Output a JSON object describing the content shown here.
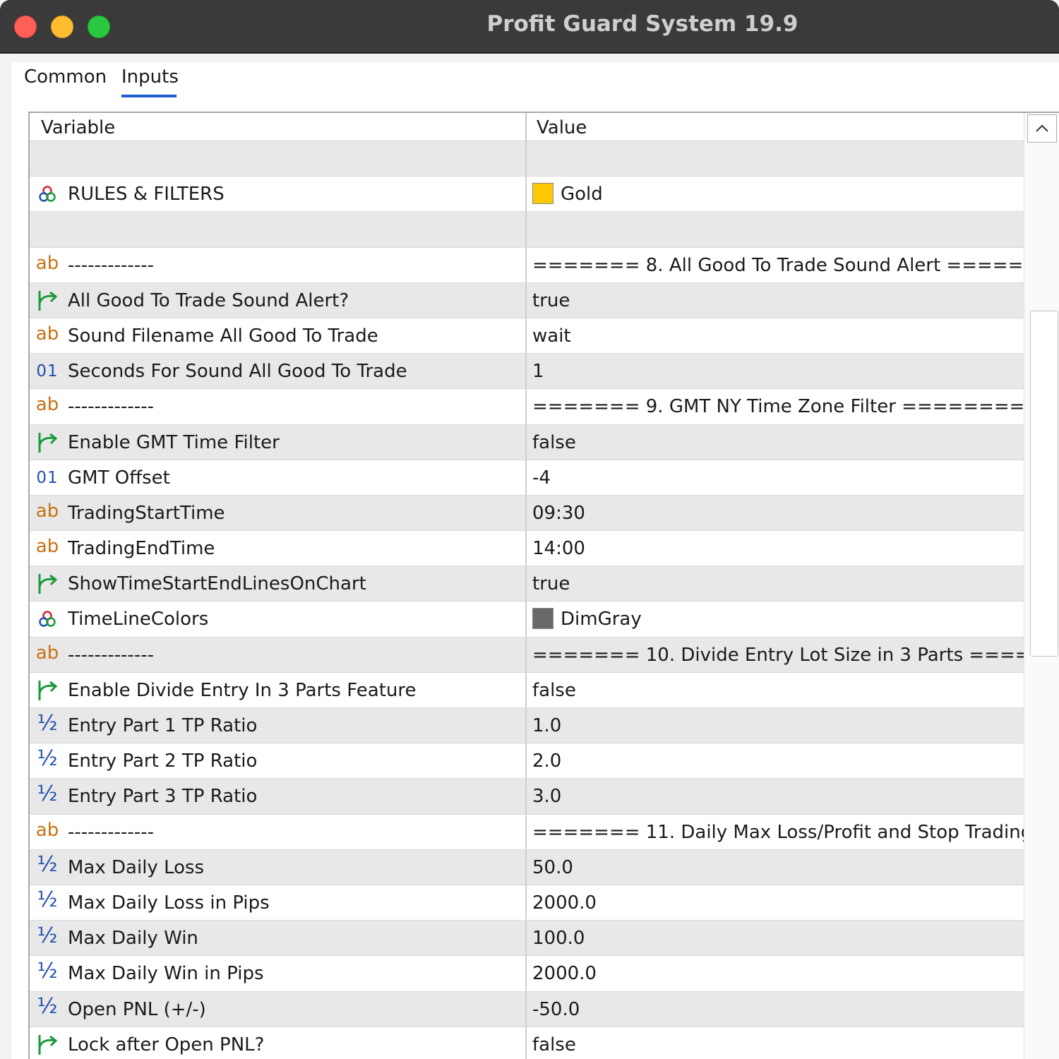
{
  "window": {
    "title": "Profit Guard System 19.9"
  },
  "tabs": [
    {
      "label": "Common"
    },
    {
      "label": "Inputs",
      "active": true
    }
  ],
  "grid": {
    "headers": {
      "variable": "Variable",
      "value": "Value"
    },
    "rows": [
      {
        "icon": "none",
        "variable": "",
        "value": "",
        "shade": "gray"
      },
      {
        "icon": "color-icon",
        "variable": "RULES & FILTERS",
        "value": "Gold",
        "swatch": "#ffc800",
        "shade": "white"
      },
      {
        "icon": "none",
        "variable": "",
        "value": "",
        "shade": "gray"
      },
      {
        "icon": "string-icon",
        "variable": "-------------",
        "value": "======= 8. All Good To Trade Sound Alert =====...",
        "shade": "white"
      },
      {
        "icon": "bool-icon",
        "variable": "All Good To Trade Sound Alert?",
        "value": "true",
        "shade": "gray"
      },
      {
        "icon": "string-icon",
        "variable": "Sound Filename All Good To Trade",
        "value": "wait",
        "shade": "white"
      },
      {
        "icon": "int-icon",
        "variable": "Seconds For Sound All Good To Trade",
        "value": "1",
        "shade": "gray"
      },
      {
        "icon": "string-icon",
        "variable": "-------------",
        "value": "======= 9. GMT NY Time Zone Filter =========...",
        "shade": "white"
      },
      {
        "icon": "bool-icon",
        "variable": "Enable GMT Time Filter",
        "value": "false",
        "shade": "gray"
      },
      {
        "icon": "int-icon",
        "variable": "GMT Offset",
        "value": "-4",
        "shade": "white"
      },
      {
        "icon": "string-icon",
        "variable": "TradingStartTime",
        "value": "09:30",
        "shade": "gray"
      },
      {
        "icon": "string-icon",
        "variable": "TradingEndTime",
        "value": "14:00",
        "shade": "white"
      },
      {
        "icon": "bool-icon",
        "variable": "ShowTimeStartEndLinesOnChart",
        "value": "true",
        "shade": "gray"
      },
      {
        "icon": "color-icon",
        "variable": "TimeLineColors",
        "value": "DimGray",
        "swatch": "#696969",
        "shade": "white"
      },
      {
        "icon": "string-icon",
        "variable": "-------------",
        "value": "======= 10. Divide Entry Lot Size in 3 Parts ====...",
        "shade": "gray"
      },
      {
        "icon": "bool-icon",
        "variable": "Enable Divide Entry In 3 Parts Feature",
        "value": "false",
        "shade": "white"
      },
      {
        "icon": "double-icon",
        "variable": "Entry Part 1 TP Ratio",
        "value": "1.0",
        "shade": "gray"
      },
      {
        "icon": "double-icon",
        "variable": "Entry Part 2 TP Ratio",
        "value": "2.0",
        "shade": "white"
      },
      {
        "icon": "double-icon",
        "variable": "Entry Part 3 TP Ratio",
        "value": "3.0",
        "shade": "gray"
      },
      {
        "icon": "string-icon",
        "variable": "-------------",
        "value": "======= 11. Daily Max Loss/Profit and Stop Trading...",
        "shade": "white"
      },
      {
        "icon": "double-icon",
        "variable": "Max Daily Loss",
        "value": "50.0",
        "shade": "gray"
      },
      {
        "icon": "double-icon",
        "variable": "Max Daily Loss in Pips",
        "value": "2000.0",
        "shade": "white"
      },
      {
        "icon": "double-icon",
        "variable": "Max Daily Win",
        "value": "100.0",
        "shade": "gray"
      },
      {
        "icon": "double-icon",
        "variable": "Max Daily Win in Pips",
        "value": "2000.0",
        "shade": "white"
      },
      {
        "icon": "double-icon",
        "variable": "Open PNL (+/-)",
        "value": "-50.0",
        "shade": "gray"
      },
      {
        "icon": "bool-icon",
        "variable": "Lock after Open PNL?",
        "value": "false",
        "shade": "white"
      }
    ]
  },
  "icon_glyphs": {
    "string-icon": "ab",
    "int-icon": "01",
    "double-icon": "½"
  },
  "colors": {
    "tab_accent": "#1f5fd6",
    "string_icon": "#c8720f",
    "numeric_icon": "#1f4fae",
    "bool_icon": "#1a9a3a"
  }
}
